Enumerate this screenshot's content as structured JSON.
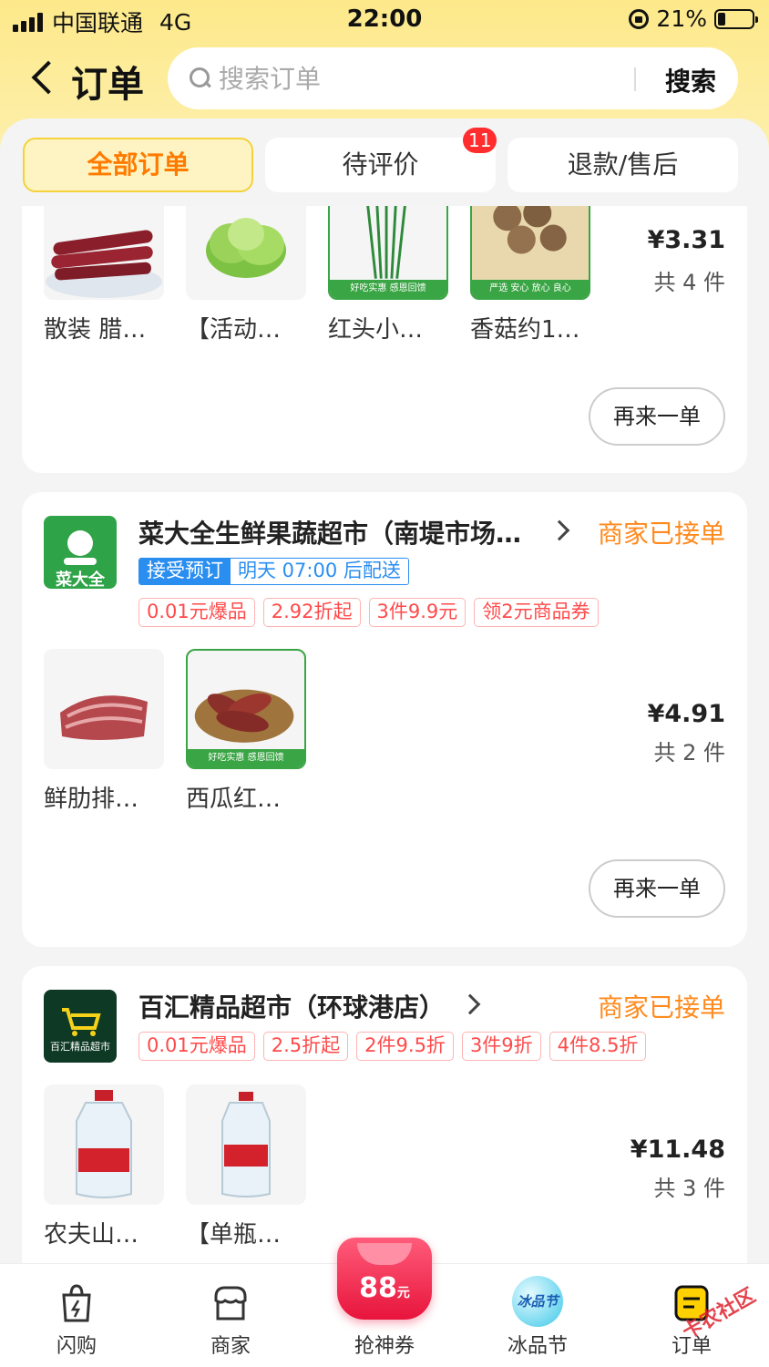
{
  "status_bar": {
    "carrier": "中国联通",
    "network": "4G",
    "time": "22:00",
    "battery": "21%"
  },
  "nav": {
    "title": "订单",
    "search_placeholder": "搜索订单",
    "search_button": "搜索"
  },
  "tabs": [
    {
      "label": "全部订单",
      "active": true
    },
    {
      "label": "待评价",
      "badge": "11"
    },
    {
      "label": "退款/售后"
    }
  ],
  "orders": [
    {
      "products": [
        {
          "name": "散装 腊…",
          "icon": "sausage-image"
        },
        {
          "name": "【活动…",
          "icon": "lettuce-image"
        },
        {
          "name": "红头小…",
          "icon": "scallion-image",
          "ribbon": "好吃实惠 感恩回馈"
        },
        {
          "name": "香菇约1…",
          "icon": "mushroom-image",
          "ribbon": "严选 安心 放心 良心"
        }
      ],
      "price": "¥3.31",
      "count": "共 4 件",
      "reorder": "再来一单"
    },
    {
      "shop": "菜大全生鲜果蔬超市（南堤市场…",
      "logo_text": "菜大全",
      "status": "商家已接单",
      "booking": {
        "tag": "接受预订",
        "text": "明天 07:00 后配送"
      },
      "tags": [
        "0.01元爆品",
        "2.92折起",
        "3件9.9元",
        "领2元商品券"
      ],
      "products": [
        {
          "name": "鲜肋排…",
          "icon": "ribs-image"
        },
        {
          "name": "西瓜红…",
          "icon": "sweet-potato-image",
          "ribbon": "好吃实惠 感恩回馈"
        }
      ],
      "price": "¥4.91",
      "count": "共 2 件",
      "reorder": "再来一单"
    },
    {
      "shop": "百汇精品超市（环球港店）",
      "logo_text": "百汇精品超市",
      "status": "商家已接单",
      "tags": [
        "0.01元爆品",
        "2.5折起",
        "2件9.5折",
        "3件9折",
        "4件8.5折"
      ],
      "products": [
        {
          "name": "农夫山…",
          "icon": "water-bottle-image"
        },
        {
          "name": "【单瓶…",
          "icon": "water-bottle-image"
        }
      ],
      "price": "¥11.48",
      "count": "共 3 件"
    }
  ],
  "bottom_nav": [
    {
      "label": "闪购",
      "icon": "shopping-bag-icon"
    },
    {
      "label": "商家",
      "icon": "store-icon"
    },
    {
      "label": "抢神券",
      "icon": "coupon-88-icon",
      "promo": "88"
    },
    {
      "label": "冰品节",
      "icon": "ice-festival-icon",
      "badge": "冰品节"
    },
    {
      "label": "订单",
      "icon": "order-icon"
    }
  ],
  "watermark": "卡农社区",
  "colors": {
    "accent": "#ff7b00",
    "status": "#ff8a1e",
    "tag": "#ff4a4a",
    "booking": "#2a8ef0",
    "header": "#fde98a"
  }
}
